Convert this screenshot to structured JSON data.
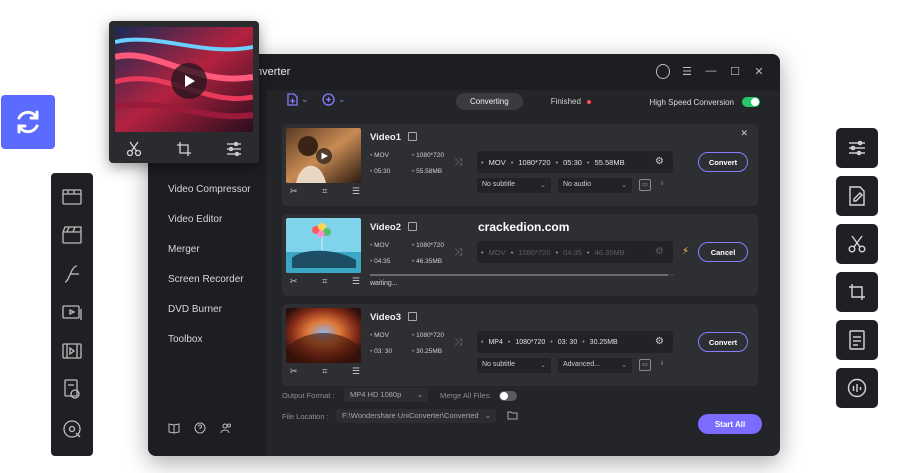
{
  "window": {
    "title": "nverter"
  },
  "sidebar": {
    "items": [
      "Video Compressor",
      "Video Editor",
      "Merger",
      "Screen Recorder",
      "DVD Burner",
      "Toolbox"
    ]
  },
  "tabs": {
    "converting": "Converting",
    "finished": "Finished"
  },
  "high_speed": {
    "label": "High Speed Conversion",
    "enabled": true
  },
  "videos": [
    {
      "name": "Video1",
      "src_format": "MOV",
      "src_res": "1080*720",
      "src_duration": "05:30",
      "src_size": "55.58MB",
      "tgt_format": "MOV",
      "tgt_res": "1080*720",
      "tgt_duration": "05:30",
      "tgt_size": "55.58MB",
      "subtitle": "No subtitle",
      "audio": "No audio",
      "action": "Convert"
    },
    {
      "name": "Video2",
      "src_format": "MOV",
      "src_res": "1080*720",
      "src_duration": "04:35",
      "src_size": "46.35MB",
      "tgt_format": "MOV",
      "tgt_res": "1080*720",
      "tgt_duration": "04:35",
      "tgt_size": "46.35MB",
      "status": "waiting...",
      "action": "Cancel",
      "progress": 0.98
    },
    {
      "name": "Video3",
      "src_format": "MOV",
      "src_res": "1080*720",
      "src_duration": "03: 30",
      "src_size": "30.25MB",
      "tgt_format": "MP4",
      "tgt_res": "1080*720",
      "tgt_duration": "03: 30",
      "tgt_size": "30.25MB",
      "subtitle": "No subtitle",
      "audio": "Advanced...",
      "action": "Convert"
    }
  ],
  "watermark": "crackedion.com",
  "footer": {
    "output_format_label": "Output Format :",
    "output_format_value": "MP4 HD 1080p",
    "merge_label": "Merge All Files:",
    "merge_enabled": false,
    "file_location_label": "File Location :",
    "file_location_value": "F:\\Wondershare UniConverter\\Converted",
    "start_all": "Start All"
  },
  "colors": {
    "accent": "#7b6bff",
    "toggle_on": "#29c56b",
    "sync_tile": "#5b6bff",
    "bolt": "#ffc53d"
  }
}
